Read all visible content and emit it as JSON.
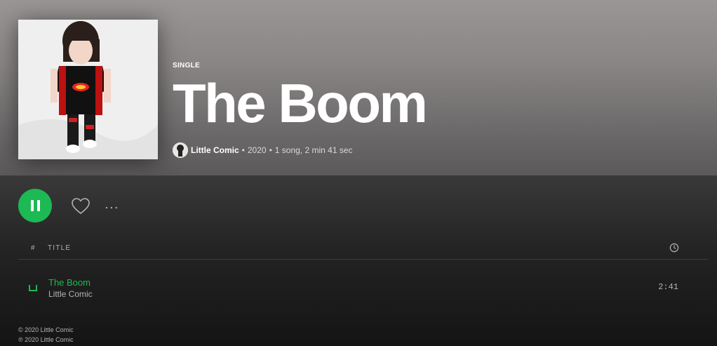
{
  "album": {
    "type_label": "SINGLE",
    "title": "The Boom",
    "artist": "Little Comic",
    "year": "2020",
    "summary": "1 song, 2 min 41 sec",
    "separator": "•"
  },
  "actions": {
    "play_state": "pause-icon",
    "like_icon": "heart-icon",
    "more_label": "..."
  },
  "table": {
    "headers": {
      "num": "#",
      "title": "TITLE",
      "duration_icon": "clock-icon"
    },
    "tracks": [
      {
        "title": "The Boom",
        "artist": "Little Comic",
        "duration": "2:41",
        "playing": true
      }
    ]
  },
  "copyright": [
    "© 2020 Little Comic",
    "℗ 2020 Little Comic"
  ],
  "colors": {
    "accent": "#1db954",
    "header_bg": "#9a9696",
    "body_bg": "#121212"
  }
}
